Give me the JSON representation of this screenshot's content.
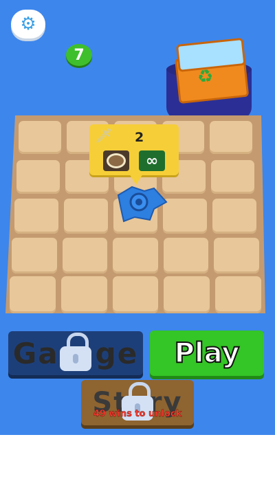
{
  "top_bar": {
    "settings_icon": "gear-icon",
    "level_badge": "7"
  },
  "board": {
    "rows": 5,
    "cols": 5,
    "tooltip": {
      "weapon_icon": "sword-icon",
      "count": "2",
      "slot_1_icon": "ring-icon",
      "slot_2_symbol": "∞",
      "slot_2_icon": "infinity-icon"
    },
    "blade_icon": "spinning-blade-icon"
  },
  "buttons": {
    "garage_label": "Garage",
    "garage_locked": true,
    "play_label": "Play",
    "story_label": "Story",
    "story_locked": true,
    "story_unlock_text": "49 wins to unlock"
  },
  "colors": {
    "background": "#3d86ec",
    "play_green": "#34c526",
    "garage_navy": "#1d3f79",
    "story_brown": "#8e6430",
    "level_green": "#3fbf2c",
    "tooltip_yellow": "#f6cf38"
  }
}
